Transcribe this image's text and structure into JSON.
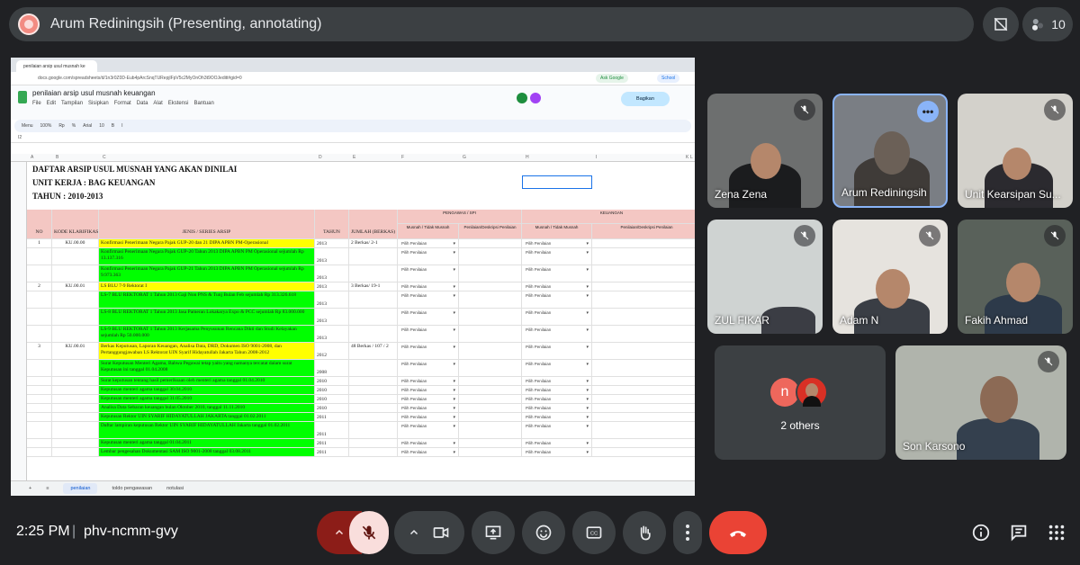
{
  "meeting": {
    "presenter_title": "Arum Rediningsih (Presenting, annotating)",
    "participant_count": "10",
    "time": "2:25 PM",
    "separator": "|",
    "code": "phv-ncmm-gvy"
  },
  "browser": {
    "tab_title": "penilaian arsip usul musnah ke",
    "url": "docs.google.com/spreadsheets/d/1n3r0Z0D-Eub4pArcSnqTURepjlFpV5c2MyOnOh3t9OOJeditt#gid=0",
    "pill_google": "Ask Google",
    "pill_school": "School"
  },
  "sheet": {
    "title": "penilaian arsip usul musnah keuangan",
    "menu": [
      "File",
      "Edit",
      "Tampilan",
      "Sisipkan",
      "Format",
      "Data",
      "Alat",
      "Ekstensi",
      "Bantuan"
    ],
    "share_label": "Bagikan",
    "toolbar": [
      "Menu",
      "100%",
      "Rp",
      "%",
      "Arial",
      "10",
      "B",
      "I"
    ],
    "cell_ref": "I2",
    "header_title": "DAFTAR ARSIP USUL MUSNAH YANG AKAN DINILAI",
    "header_unit": "UNIT KERJA : BAG KEUANGAN",
    "header_year": "TAHUN : 2010-2013",
    "col_letters": [
      "A",
      "B",
      "C",
      "D",
      "E",
      "F",
      "G",
      "H",
      "I",
      "J",
      "K",
      "L"
    ],
    "headers": {
      "no": "NO",
      "kode": "KODE KLARIFIKASI",
      "jenis": "JENIS / SERIES ARSIP",
      "tahun": "TAHUN",
      "jumlah": "JUMLAH (BERKAS)",
      "pengawas": "PENGAWAS / SPI",
      "keuangan": "KEUANGAN",
      "musnah": "Musnah / Tidak Musnah",
      "deskripsi": "Penilaian/Deskripsi Penilaian"
    },
    "dropdown": "Pilih Penilaian",
    "rows": [
      {
        "no": "1",
        "kode": "KU.00.00",
        "jenis": "Konfirmasi Penerimaan Negara Pajak GUP-20 dan 21 DIPA APBN PM-Operasional",
        "tahun": "2013",
        "jumlah": "2 Berkas/ 2-1",
        "color": "yellow"
      },
      {
        "no": "",
        "kode": "",
        "jenis": "Konfirmasi Penerimaan Negara Pajak GUP-20 Tahun 2013 DIPA APBN PM Operasional sejumlah Rp 13.137.316",
        "tahun": "2013",
        "jumlah": "",
        "color": "green"
      },
      {
        "no": "",
        "kode": "",
        "jenis": "Konfirmasi Penerimaan Negara Pajak GUP-21 Tahun 2013 DIPA APBN PM Operasional sejumlah Rp 9.973.363",
        "tahun": "2013",
        "jumlah": "",
        "color": "green"
      },
      {
        "no": "2",
        "kode": "KU.00.01",
        "jenis": "LS BLU 7-9 Rektorat I",
        "tahun": "2013",
        "jumlah": "3 Berkas/ 19-1",
        "color": "yellow"
      },
      {
        "no": "",
        "kode": "",
        "jenis": "LS-7 BLU REKTORAT 1 Tahun 2013 Gaji Non PNS & Tunj Bulan Feb sejumlah Rp 313.326.618",
        "tahun": "2013",
        "jumlah": "",
        "color": "green"
      },
      {
        "no": "",
        "kode": "",
        "jenis": "LS-8 BLU REKTORAT 1 Tahun 2013 Jasa Pameran Lokakarya Expo & PCC sejumlah Rp 83.000.000",
        "tahun": "2013",
        "jumlah": "",
        "color": "green"
      },
      {
        "no": "",
        "kode": "",
        "jenis": "LS-9 BLU REKTORAT 1 Tahun 2013 Kerjasama Penyusunan Rencana Dikti dan Studi Kelayakan sejumlah Rp 50.000.000",
        "tahun": "2013",
        "jumlah": "",
        "color": "green"
      },
      {
        "no": "3",
        "kode": "KU.00.01",
        "jenis": "Berkas Keputusan, Laporan Keuangan, Analisa Data, DRD, Dokumen ISO 9001-2008, dan Pertanggungjawaban LS Rektorat UIN Syarif Hidayatullah Jakarta Tahun 2008-2012",
        "tahun": "2012",
        "jumlah": "48 Berkas / 107 / 2",
        "color": "yellow"
      },
      {
        "no": "",
        "kode": "",
        "jenis": "Surat Keputusan Menteri Agama, Bahwa Pegawai tetap yaitu yang namanya tercatat dalam surat Keputusan ini tanggal 01.04.2008",
        "tahun": "2008",
        "jumlah": "",
        "color": "green"
      },
      {
        "no": "",
        "kode": "",
        "jenis": "Surat keputusan tentang hasil pemeriksaan oleh menteri agama tanggal 01.04.2010",
        "tahun": "2010",
        "jumlah": "",
        "color": "green"
      },
      {
        "no": "",
        "kode": "",
        "jenis": "Keputusan menteri agama tanggal 30.04.2010",
        "tahun": "2010",
        "jumlah": "",
        "color": "green"
      },
      {
        "no": "",
        "kode": "",
        "jenis": "Keputusan menteri agama tanggal 31.05.2010",
        "tahun": "2010",
        "jumlah": "",
        "color": "green"
      },
      {
        "no": "",
        "kode": "",
        "jenis": "Analisa Data Sebaran keuangan bulan Oktober 2010, tanggal 11.11.2010",
        "tahun": "2010",
        "jumlah": "",
        "color": "green"
      },
      {
        "no": "",
        "kode": "",
        "jenis": "Keputusan Rektor UIN SYARIF HIDAYATULLAH JAKARTA tanggal 01.02.2011",
        "tahun": "2011",
        "jumlah": "",
        "color": "green"
      },
      {
        "no": "",
        "kode": "",
        "jenis": "Daftar lampiran keputusan Rektor UIN SYARIF HIDAYATULLAH Jakarta tanggal 01.02.2011",
        "tahun": "2011",
        "jumlah": "",
        "color": "green"
      },
      {
        "no": "",
        "kode": "",
        "jenis": "Keputusan menteri agama tanggal 01.04.2011",
        "tahun": "2011",
        "jumlah": "",
        "color": "green"
      },
      {
        "no": "",
        "kode": "",
        "jenis": "Lembar pengesahan Dokumentasi SAM ISO 9001-2008 tanggal 03.08.2011",
        "tahun": "2011",
        "jumlah": "",
        "color": "green"
      }
    ],
    "tabs": [
      "penilaian",
      "toldo pengawasan",
      "notulasi"
    ]
  },
  "participants": [
    {
      "name": "Zena Zena"
    },
    {
      "name": "Arum Rediningsih"
    },
    {
      "name": "Unit Kearsipan Su..."
    },
    {
      "name": "ZUL FIKAR"
    },
    {
      "name": "Adam N"
    },
    {
      "name": "Fakih Ahmad"
    },
    {
      "name": "2 others",
      "initial": "n"
    },
    {
      "name": "Son Karsono"
    }
  ],
  "colors": {
    "bg": "#202124",
    "end_call": "#ea4335",
    "active_tile": "#8ab4f8"
  }
}
